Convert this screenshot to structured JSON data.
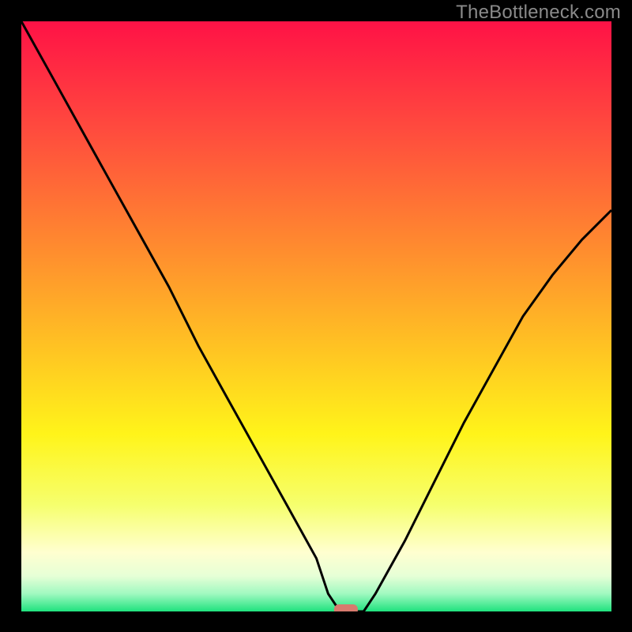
{
  "watermark": "TheBottleneck.com",
  "chart_data": {
    "type": "line",
    "title": "",
    "xlabel": "",
    "ylabel": "",
    "xlim": [
      0,
      100
    ],
    "ylim": [
      0,
      100
    ],
    "x": [
      0,
      5,
      10,
      15,
      20,
      25,
      30,
      35,
      40,
      45,
      50,
      52,
      54,
      56,
      58,
      60,
      65,
      70,
      75,
      80,
      85,
      90,
      95,
      100
    ],
    "values": [
      100,
      91,
      82,
      73,
      64,
      55,
      45,
      36,
      27,
      18,
      9,
      3,
      0,
      0,
      0,
      3,
      12,
      22,
      32,
      41,
      50,
      57,
      63,
      68
    ],
    "marker": {
      "x": 55,
      "y": 0,
      "color": "#d77a6e",
      "shape": "rounded-rect"
    },
    "gradient_stops": [
      {
        "offset": 0.0,
        "color": "#ff1246"
      },
      {
        "offset": 0.18,
        "color": "#ff4a3e"
      },
      {
        "offset": 0.38,
        "color": "#ff8a2f"
      },
      {
        "offset": 0.55,
        "color": "#ffc223"
      },
      {
        "offset": 0.7,
        "color": "#fff41a"
      },
      {
        "offset": 0.82,
        "color": "#f6ff6e"
      },
      {
        "offset": 0.9,
        "color": "#ffffd0"
      },
      {
        "offset": 0.94,
        "color": "#e6ffd6"
      },
      {
        "offset": 0.97,
        "color": "#a0f9c0"
      },
      {
        "offset": 1.0,
        "color": "#1fe27e"
      }
    ]
  }
}
